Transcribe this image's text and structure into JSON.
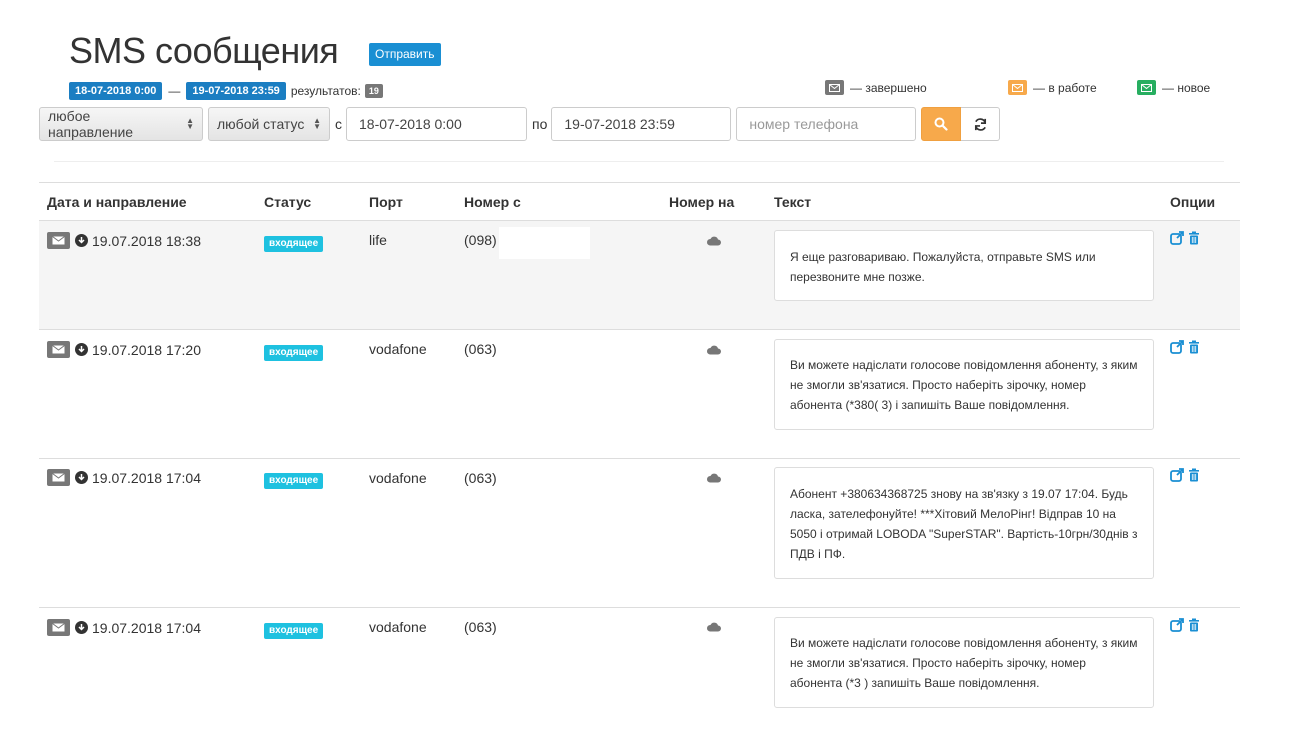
{
  "header": {
    "title": "SMS сообщения",
    "send_label": "Отправить"
  },
  "range": {
    "from": "18-07-2018 0:00",
    "dash": "—",
    "to": "19-07-2018 23:59",
    "results_label": "результатов:",
    "count": "19"
  },
  "legend": [
    {
      "label": "— завершено",
      "color": "#777777"
    },
    {
      "label": "— в работе",
      "color": "#f7a94b"
    },
    {
      "label": "— новое",
      "color": "#27ae60"
    }
  ],
  "filters": {
    "direction": "любое направление",
    "status": "любой статус",
    "from_label": "с",
    "from_value": "18-07-2018 0:00",
    "to_label": "по",
    "to_value": "19-07-2018 23:59",
    "phone_placeholder": "номер телефона"
  },
  "table": {
    "headers": [
      "Дата и направление",
      "Статус",
      "Порт",
      "Номер с",
      "Номер на",
      "Текст",
      "Опции"
    ],
    "rows": [
      {
        "datetime": "19.07.2018 18:38",
        "status": "входящее",
        "port": "life",
        "number_from": "(098)",
        "text": "Я еще разговариваю. Пожалуйста, отправьте SMS или перезвоните мне позже."
      },
      {
        "datetime": "19.07.2018 17:20",
        "status": "входящее",
        "port": "vodafone",
        "number_from": "(063)",
        "text": "Ви можете надіслати голосове повідомлення абоненту, з яким не змогли зв'язатися. Просто наберіть зірочку, номер абонента (*380(                3) і запишіть Ваше повідомлення."
      },
      {
        "datetime": "19.07.2018 17:04",
        "status": "входящее",
        "port": "vodafone",
        "number_from": "(063)",
        "text": "Абонент +380634368725 знову на зв'язку з 19.07 17:04. Будь ласка, зателефонуйте! ***Хітовий МелоРінг! Відправ 10 на 5050 і отримай LOBODA \"SuperSTAR\". Вартість-10грн/30днів з ПДВ і ПФ."
      },
      {
        "datetime": "19.07.2018 17:04",
        "status": "входящее",
        "port": "vodafone",
        "number_from": "(063)",
        "text": "Ви можете надіслати голосове повідомлення абоненту, з яким не змогли зв'язатися. Просто наберіть зірочку, номер абонента (*3                      ) запишіть Ваше повідомлення."
      }
    ]
  },
  "icons": {
    "envelope": "envelope-icon",
    "download": "download-circle-icon",
    "cloud": "cloud-icon",
    "search": "search-icon",
    "refresh": "refresh-icon",
    "external": "external-link-icon",
    "trash": "trash-icon"
  }
}
